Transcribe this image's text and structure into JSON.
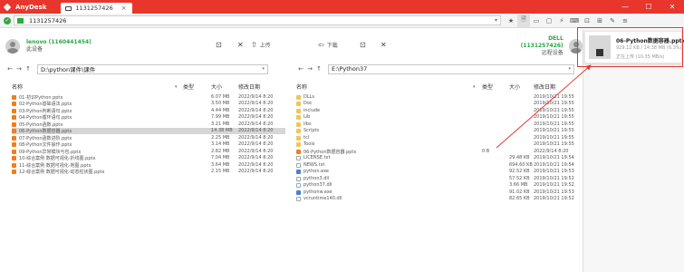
{
  "app": {
    "name": "AnyDesk",
    "tab_label": "1131257426"
  },
  "window_controls": {
    "minimize": "—",
    "maximize": "☐",
    "close": "✕"
  },
  "address": {
    "value": "1131257426"
  },
  "colors": {
    "titlebar": "#e8362d",
    "accent_green": "#28a745",
    "selection": "#d6d6d6"
  },
  "toolbar_icons": [
    "file-transfer-icon",
    "display-icon",
    "chat-icon",
    "actions-icon",
    "keyboard-icon",
    "record-icon",
    "switch-sides-icon",
    "draw-icon",
    "menu-icon"
  ],
  "local": {
    "peer_name": "lenovo (1160441454)",
    "peer_sub": "此设备",
    "upload_label": "上传",
    "path": "D:\\python课件\\课件",
    "columns": {
      "name": "名称",
      "type": "类型",
      "size": "大小",
      "date": "修改日期"
    },
    "files": [
      {
        "name": "01-初识Python.pptx",
        "size": "6.07 MB",
        "date": "2022/9/14 8:20"
      },
      {
        "name": "02-Python基础语法.pptx",
        "size": "3.50 MB",
        "date": "2022/9/14 8:20"
      },
      {
        "name": "03-Python判断语句.pptx",
        "size": "4.44 MB",
        "date": "2022/9/14 8:20"
      },
      {
        "name": "04-Python循环语句.pptx",
        "size": "7.99 MB",
        "date": "2022/9/14 8:20"
      },
      {
        "name": "05-Python函数.pptx",
        "size": "3.21 MB",
        "date": "2022/9/14 8:20"
      },
      {
        "name": "06-Python数据容器.pptx",
        "size": "14.38 MB",
        "date": "2022/9/14 8:20"
      },
      {
        "name": "07-Python函数进阶.pptx",
        "size": "2.25 MB",
        "date": "2022/9/14 8:20"
      },
      {
        "name": "08-Python文件操作.pptx",
        "size": "3.14 MB",
        "date": "2022/9/14 8:20"
      },
      {
        "name": "09-Python异常模块与包.pptx",
        "size": "2.82 MB",
        "date": "2022/9/14 8:20"
      },
      {
        "name": "10-综合案例 数据可视化-折线图.pptx",
        "size": "7.04 MB",
        "date": "2022/9/14 8:20"
      },
      {
        "name": "11-综合案例 数据可视化-地图.pptx",
        "size": "3.64 MB",
        "date": "2022/9/14 8:20"
      },
      {
        "name": "12-综合案例 数据可视化-动态柱状图.pptx",
        "size": "2.15 MB",
        "date": "2022/9/14 8:20"
      }
    ],
    "selected_index": 5
  },
  "remote": {
    "peer_name": "DELL (1131257426)",
    "peer_sub": "远程设备",
    "download_label": "下载",
    "path": "E:\\Python37",
    "columns": {
      "name": "名称",
      "type": "类型",
      "size": "大小",
      "date": "修改日期"
    },
    "files": [
      {
        "name": "DLLs",
        "kind": "dir",
        "type": "",
        "size": "",
        "date": "2019/10/21 19:55"
      },
      {
        "name": "Doc",
        "kind": "dir",
        "type": "",
        "size": "",
        "date": "2019/10/21 19:55"
      },
      {
        "name": "include",
        "kind": "dir",
        "type": "",
        "size": "",
        "date": "2019/10/21 19:55"
      },
      {
        "name": "Lib",
        "kind": "dir",
        "type": "",
        "size": "",
        "date": "2019/10/21 19:55"
      },
      {
        "name": "libs",
        "kind": "dir",
        "type": "",
        "size": "",
        "date": "2019/10/21 19:55"
      },
      {
        "name": "Scripts",
        "kind": "dir",
        "type": "",
        "size": "",
        "date": "2019/10/21 19:55"
      },
      {
        "name": "tcl",
        "kind": "dir",
        "type": "",
        "size": "",
        "date": "2019/10/21 19:55"
      },
      {
        "name": "Tools",
        "kind": "dir",
        "type": "",
        "size": "",
        "date": "2019/10/21 19:55"
      },
      {
        "name": "06-Python数据容器.pptx",
        "kind": "ppt",
        "type": "0 B",
        "size": "",
        "date": "2022/9/14 8:20"
      },
      {
        "name": "LICENSE.txt",
        "kind": "file",
        "type": "",
        "size": "29.48 KB",
        "date": "2019/10/21 19:54"
      },
      {
        "name": "NEWS.txt",
        "kind": "file",
        "type": "",
        "size": "694.60 KB",
        "date": "2019/10/21 19:54"
      },
      {
        "name": "python.exe",
        "kind": "exe",
        "type": "",
        "size": "92.52 KB",
        "date": "2019/10/21 19:53"
      },
      {
        "name": "python3.dll",
        "kind": "file",
        "type": "",
        "size": "57.52 KB",
        "date": "2019/10/21 19:52"
      },
      {
        "name": "python37.dll",
        "kind": "file",
        "type": "",
        "size": "3.66 MB",
        "date": "2019/10/21 19:52"
      },
      {
        "name": "pythonw.exe",
        "kind": "exe",
        "type": "",
        "size": "91.02 KB",
        "date": "2019/10/21 19:53"
      },
      {
        "name": "vcruntime140.dll",
        "kind": "file",
        "type": "",
        "size": "82.65 KB",
        "date": "2019/10/21 19:52"
      }
    ]
  },
  "transfer": {
    "file_name": "06-Python数据容器.pptx",
    "size_line": "929.12 KB / 14.38 MB (6.3%)",
    "status_line": "正在上传 (10.35 MB/s)",
    "progress_percent": 6.3
  }
}
